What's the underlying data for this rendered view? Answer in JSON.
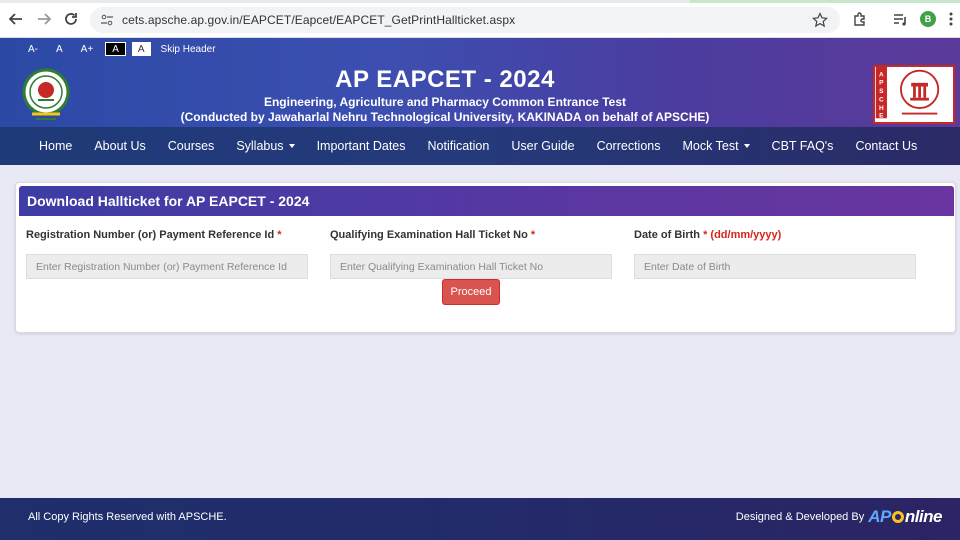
{
  "browser": {
    "url": "cets.apsche.ap.gov.in/EAPCET/Eapcet/EAPCET_GetPrintHallticket.aspx",
    "profile_initial": "B"
  },
  "accessibility": {
    "font_decrease": "A-",
    "font_normal": "A",
    "font_increase": "A+",
    "theme_dark": "A",
    "theme_light": "A",
    "skip_header": "Skip Header"
  },
  "header": {
    "title": "AP EAPCET - 2024",
    "subtitle": "Engineering, Agriculture and Pharmacy Common Entrance Test",
    "conducted_by": "(Conducted by Jawaharlal Nehru Technological University, KAKINADA on behalf of APSCHE)",
    "right_logo_text": "APSCHE"
  },
  "nav": {
    "items": [
      {
        "label": "Home"
      },
      {
        "label": "About Us"
      },
      {
        "label": "Courses"
      },
      {
        "label": "Syllabus"
      },
      {
        "label": "Important Dates"
      },
      {
        "label": "Notification"
      },
      {
        "label": "User Guide"
      },
      {
        "label": "Corrections"
      },
      {
        "label": "Mock Test"
      },
      {
        "label": "CBT FAQ's"
      },
      {
        "label": "Contact Us"
      }
    ]
  },
  "form": {
    "heading": "Download Hallticket for AP EAPCET - 2024",
    "fields": [
      {
        "label": "Registration Number (or) Payment Reference Id",
        "required": "*",
        "hint": "",
        "placeholder": "Enter Registration Number (or) Payment Reference Id"
      },
      {
        "label": "Qualifying Examination Hall Ticket No",
        "required": "*",
        "hint": "",
        "placeholder": "Enter Qualifying Examination Hall Ticket No"
      },
      {
        "label": "Date of Birth",
        "required": "*",
        "hint": "(dd/mm/yyyy)",
        "placeholder": "Enter Date of Birth"
      }
    ],
    "submit_label": "Proceed"
  },
  "footer": {
    "copyright": "All Copy Rights Reserved with APSCHE.",
    "designed_by": "Designed & Developed By",
    "brand_ap": "AP",
    "brand_online": "nline"
  },
  "colors": {
    "header_blue": "#2c49a6",
    "header_purple": "#5b3a9a",
    "proceed_red": "#d9534f",
    "required_red": "#d9241c",
    "page_bg": "#e9e9f6"
  }
}
